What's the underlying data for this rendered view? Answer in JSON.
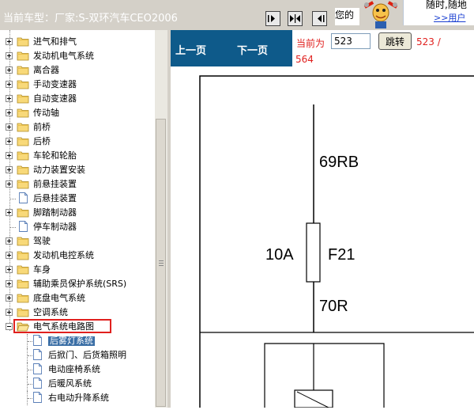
{
  "header": {
    "vehicle_label": "当前车型：厂家:S-双环汽车CEO2006",
    "nav_buttons": [
      "first-page",
      "split-view",
      "last-page"
    ],
    "user_text": "您的",
    "promo_line1": "随时,随地",
    "promo_link": ">>用户"
  },
  "tree": {
    "items": [
      {
        "label": "进气和排气",
        "type": "folder"
      },
      {
        "label": "发动机电气系统",
        "type": "folder"
      },
      {
        "label": "离合器",
        "type": "folder"
      },
      {
        "label": "手动变速器",
        "type": "folder"
      },
      {
        "label": "自动变速器",
        "type": "folder"
      },
      {
        "label": "传动轴",
        "type": "folder"
      },
      {
        "label": "前桥",
        "type": "folder"
      },
      {
        "label": "后桥",
        "type": "folder"
      },
      {
        "label": "车轮和轮胎",
        "type": "folder"
      },
      {
        "label": "动力装置安装",
        "type": "folder"
      },
      {
        "label": "前悬挂装置",
        "type": "folder"
      },
      {
        "label": "后悬挂装置",
        "type": "doc"
      },
      {
        "label": "脚踏制动器",
        "type": "folder"
      },
      {
        "label": "停车制动器",
        "type": "doc"
      },
      {
        "label": "驾驶",
        "type": "folder"
      },
      {
        "label": "发动机电控系统",
        "type": "folder"
      },
      {
        "label": "车身",
        "type": "folder"
      },
      {
        "label": "辅助乘员保护系统(SRS)",
        "type": "folder"
      },
      {
        "label": "底盘电气系统",
        "type": "folder"
      },
      {
        "label": "空调系统",
        "type": "folder"
      },
      {
        "label": "电气系统电路图",
        "type": "folder-open"
      }
    ],
    "children": [
      {
        "label": "后雾灯系统",
        "selected": true
      },
      {
        "label": "后掀门、后货箱照明"
      },
      {
        "label": "电动座椅系统"
      },
      {
        "label": "后暖风系统"
      },
      {
        "label": "右电动升降系统"
      }
    ]
  },
  "pagebar": {
    "prev_label": "上一页",
    "next_label": "下一页",
    "current_label": "当前为",
    "page_value": "523",
    "go_label": "跳转",
    "total_line1": "523 /",
    "total_line2": "564"
  },
  "diagram": {
    "wire_top": "69RB",
    "fuse_rating": "10A",
    "fuse_id": "F21",
    "wire_bottom": "70R"
  }
}
